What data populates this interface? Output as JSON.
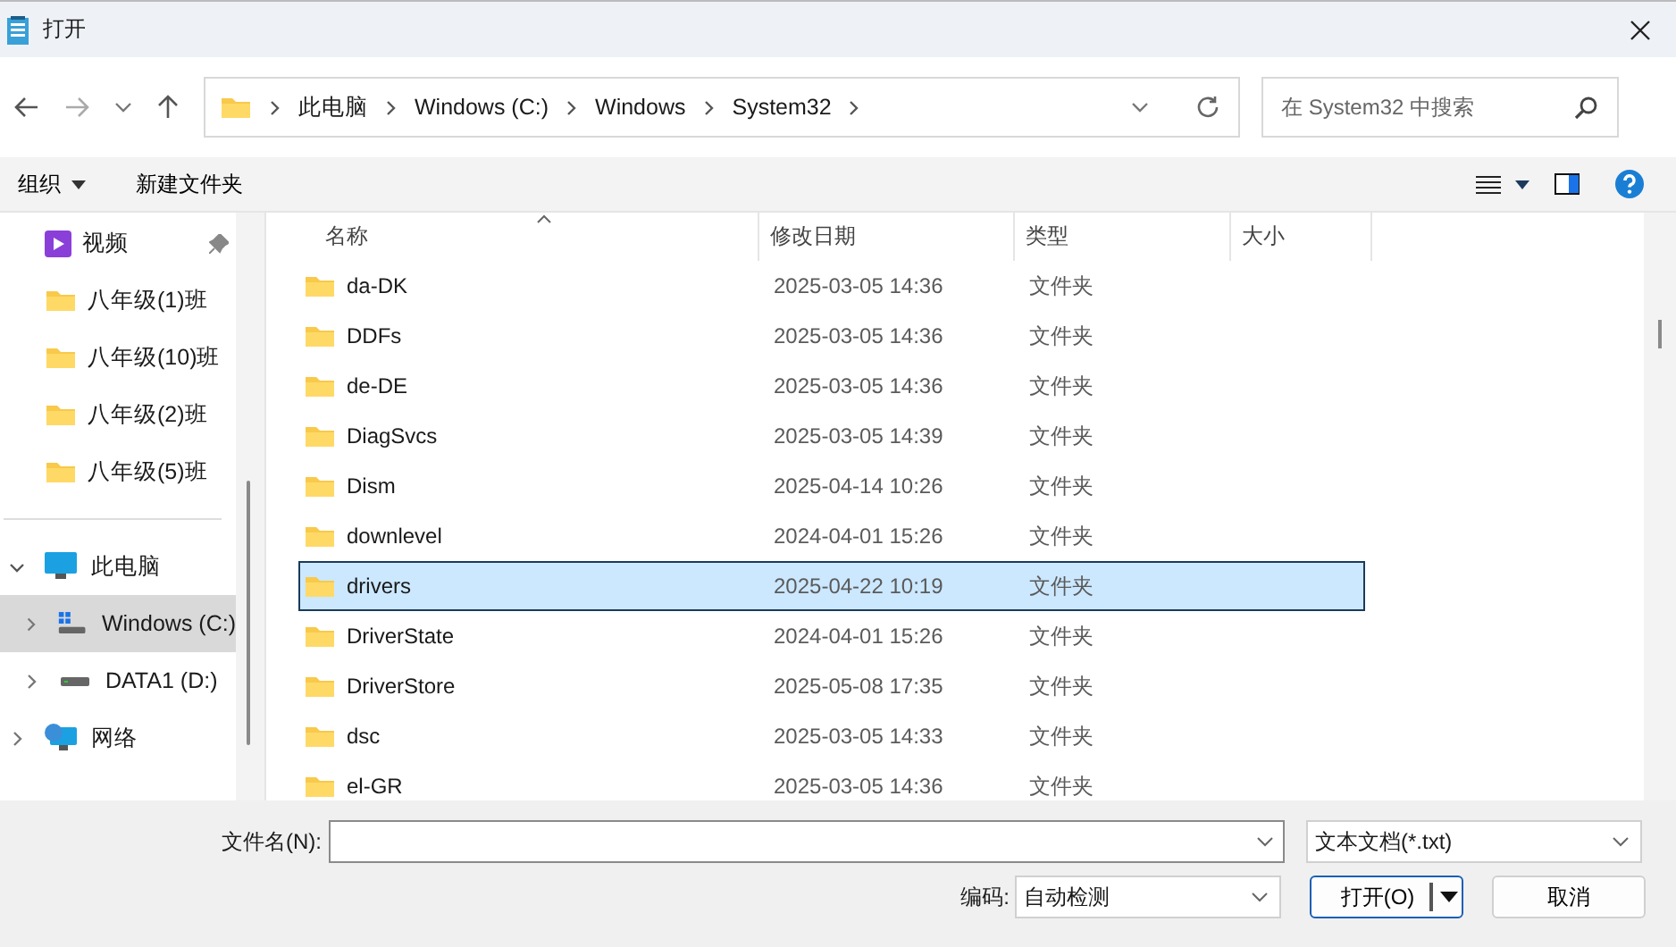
{
  "window": {
    "title": "打开"
  },
  "address": {
    "crumbs": [
      "此电脑",
      "Windows (C:)",
      "Windows",
      "System32"
    ]
  },
  "search": {
    "placeholder": "在 System32 中搜索"
  },
  "toolbar": {
    "organize": "组织",
    "new_folder": "新建文件夹"
  },
  "sidebar": {
    "quick_access": [
      {
        "label": "视频",
        "kind": "video",
        "pinned": true
      },
      {
        "label": "八年级(1)班",
        "kind": "folder",
        "pinned": false
      },
      {
        "label": "八年级(10)班",
        "kind": "folder",
        "pinned": false
      },
      {
        "label": "八年级(2)班",
        "kind": "folder",
        "pinned": false
      },
      {
        "label": "八年级(5)班",
        "kind": "folder",
        "pinned": false
      }
    ],
    "tree": [
      {
        "label": "此电脑",
        "kind": "pc",
        "expanded": true,
        "selected": false,
        "children": [
          {
            "label": "Windows (C:)",
            "kind": "system-drive",
            "expanded": false,
            "selected": true
          },
          {
            "label": "DATA1 (D:)",
            "kind": "drive",
            "expanded": false,
            "selected": false
          }
        ]
      },
      {
        "label": "网络",
        "kind": "network",
        "expanded": false,
        "selected": false
      }
    ]
  },
  "table": {
    "columns": [
      {
        "label": "名称",
        "sorted": true
      },
      {
        "label": "修改日期",
        "sorted": false
      },
      {
        "label": "类型",
        "sorted": false
      },
      {
        "label": "大小",
        "sorted": false
      }
    ],
    "rows": [
      {
        "name": "da-DK",
        "modified": "2025-03-05 14:36",
        "type": "文件夹",
        "selected": false
      },
      {
        "name": "DDFs",
        "modified": "2025-03-05 14:36",
        "type": "文件夹",
        "selected": false
      },
      {
        "name": "de-DE",
        "modified": "2025-03-05 14:36",
        "type": "文件夹",
        "selected": false
      },
      {
        "name": "DiagSvcs",
        "modified": "2025-03-05 14:39",
        "type": "文件夹",
        "selected": false
      },
      {
        "name": "Dism",
        "modified": "2025-04-14 10:26",
        "type": "文件夹",
        "selected": false
      },
      {
        "name": "downlevel",
        "modified": "2024-04-01 15:26",
        "type": "文件夹",
        "selected": false
      },
      {
        "name": "drivers",
        "modified": "2025-04-22 10:19",
        "type": "文件夹",
        "selected": true
      },
      {
        "name": "DriverState",
        "modified": "2024-04-01 15:26",
        "type": "文件夹",
        "selected": false
      },
      {
        "name": "DriverStore",
        "modified": "2025-05-08 17:35",
        "type": "文件夹",
        "selected": false
      },
      {
        "name": "dsc",
        "modified": "2025-03-05 14:33",
        "type": "文件夹",
        "selected": false
      },
      {
        "name": "el-GR",
        "modified": "2025-03-05 14:36",
        "type": "文件夹",
        "selected": false
      }
    ]
  },
  "bottom": {
    "filename_label": "文件名(N):",
    "file_type": "文本文档(*.txt)",
    "encoding_label": "编码:",
    "encoding": "自动检测",
    "open_button": "打开(O)",
    "cancel_button": "取消"
  }
}
